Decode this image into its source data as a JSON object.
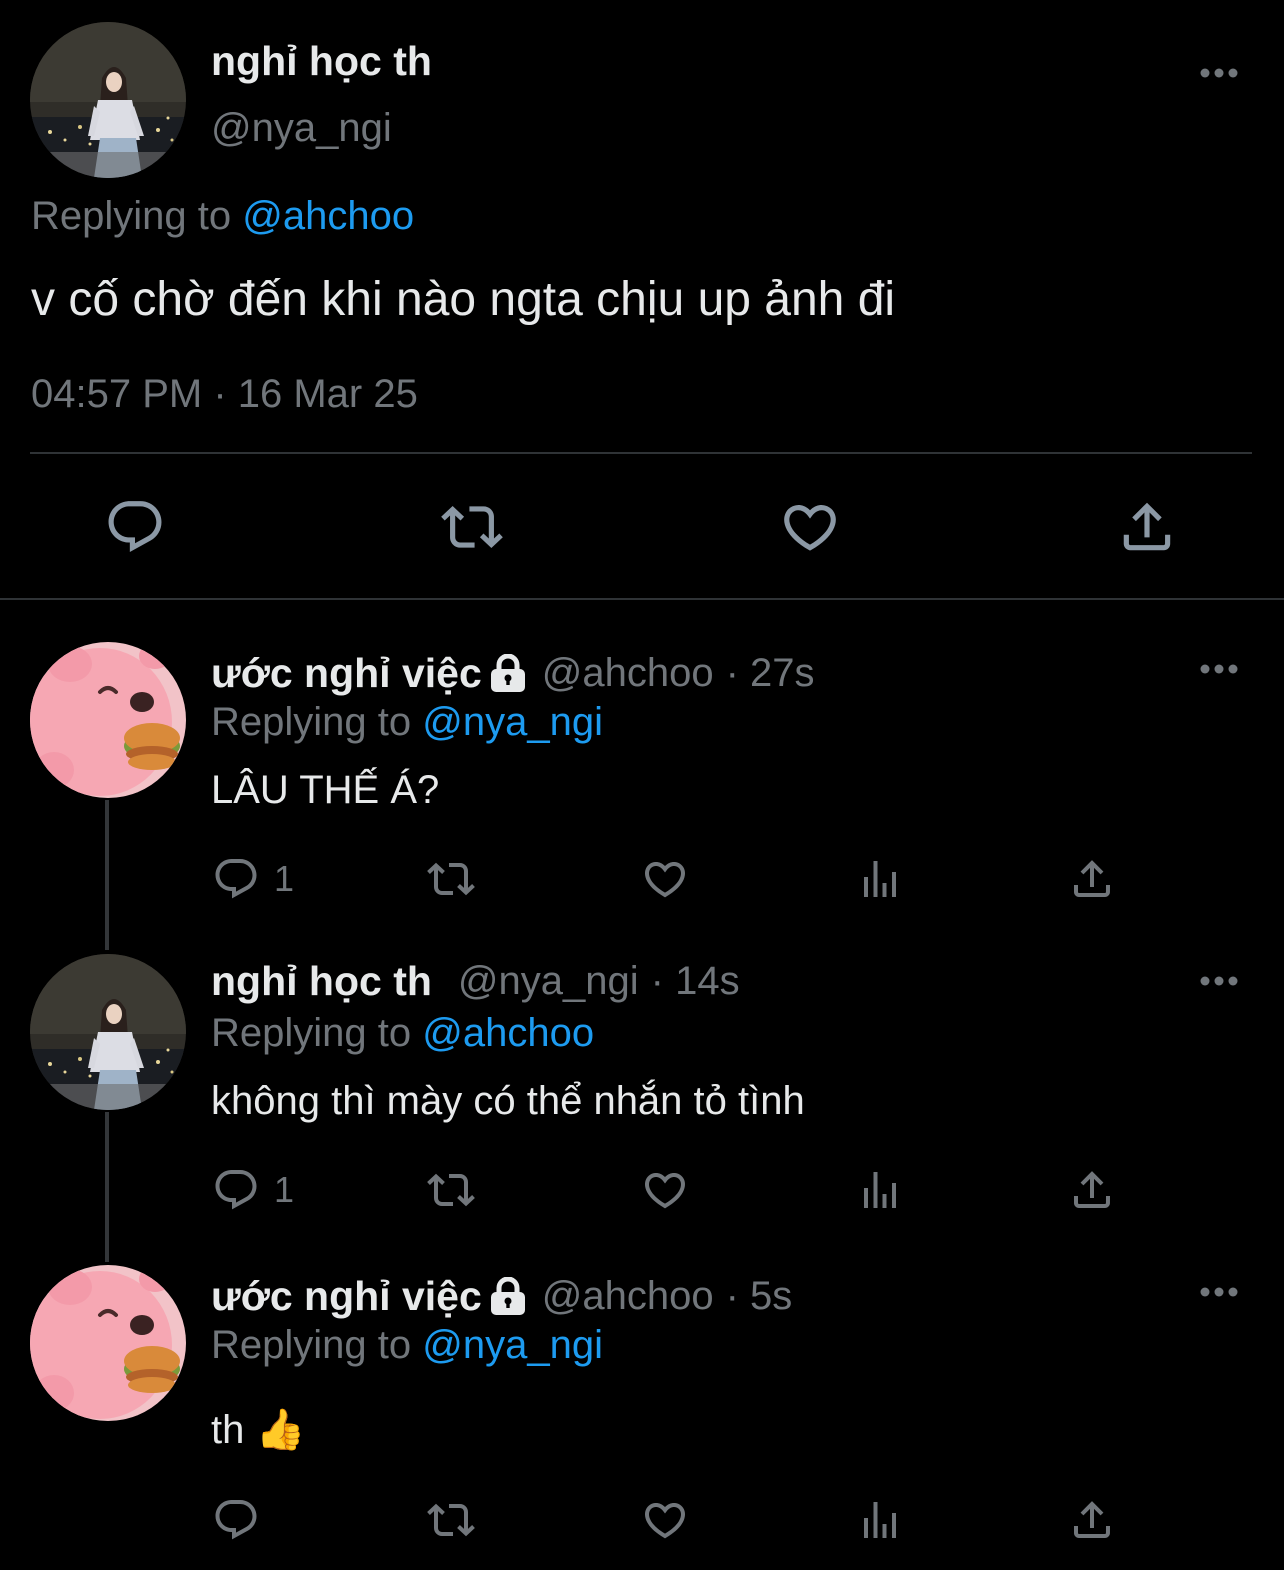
{
  "main_tweet": {
    "display_name": "nghỉ học th",
    "handle": "@nya_ngi",
    "replying_to_label": "Replying to",
    "replying_to_handle": "@ahchoo",
    "text": "v cố chờ đến khi nào ngta chịu up ảnh đi",
    "timestamp": "04:57 PM · 16 Mar 25",
    "icons": [
      "reply-icon",
      "retweet-icon",
      "like-icon",
      "share-icon"
    ]
  },
  "replies": [
    {
      "display_name": "ước nghỉ việc",
      "locked": true,
      "handle": "@ahchoo",
      "time": "· 27s",
      "replying_to_label": "Replying to",
      "replying_to_handle": "@nya_ngi",
      "text": "LÂU THẾ Á?",
      "reply_count": "1"
    },
    {
      "display_name": "nghỉ học th",
      "locked": false,
      "handle": "@nya_ngi",
      "time": "· 14s",
      "replying_to_label": "Replying to",
      "replying_to_handle": "@ahchoo",
      "text": "không thì mày có thể nhắn tỏ tình",
      "reply_count": "1"
    },
    {
      "display_name": "ước nghỉ việc",
      "locked": true,
      "handle": "@ahchoo",
      "time": "· 5s",
      "replying_to_label": "Replying to",
      "replying_to_handle": "@nya_ngi",
      "text": "th 👍",
      "reply_count": ""
    }
  ],
  "colors": {
    "background": "#000000",
    "text": "#e7e9ea",
    "secondary": "#71767b",
    "accent": "#1d9bf0",
    "divider": "#2f3336"
  }
}
